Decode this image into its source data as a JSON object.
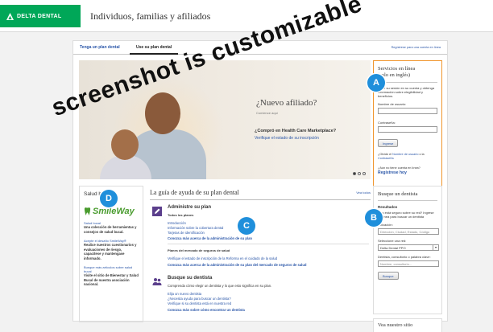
{
  "header": {
    "brand": "DELTA DENTAL",
    "title": "Individuos, familias y afiliados"
  },
  "tabs": [
    {
      "label": "Tenga un plan dental"
    },
    {
      "label": "Use su plan dental"
    }
  ],
  "register_link": "Regístrese para una cuenta en línea",
  "hero": {
    "title": "¿Nuevo afiliado?",
    "subtitle": "Comience aquí",
    "question": "¿Compró en Health Care Marketplace?",
    "link": "Verifique el estado de su inscripción"
  },
  "login": {
    "title_line1": "Servicios en línea",
    "title_line2": "(solo en inglés)",
    "desc": "Inicie su sesión en su cuenta y obtenga información sobre elegibilidad y beneficios.",
    "username_label": "Nombre de usuario:",
    "password_label": "Contraseña:",
    "submit": "Ingrese",
    "forgot_prefix": "¿Olvidó el",
    "forgot_user": "Nombre de usuario",
    "forgot_mid": "o la",
    "forgot_pass": "Contraseña",
    "no_account": "¿Aún no tiene cuenta en línea?",
    "register": "Regístrese hoy"
  },
  "oral_health": {
    "title": "Salud bucal",
    "brand": "SmileWay",
    "line1": "Salud bucal",
    "text": "Una colección de herramientas y consejos de salud bucal.",
    "link": "Acepte el desafío SmileWay®",
    "bold_text": "Realice nuestros cuestionarios y evaluaciones de riesgo, capacítese y mantengase informado.",
    "more_link": "Busque más artículos sobre salud bucal",
    "footer_text": "Visite el sitio de Bienestar y Salud Bucal de nuestra asociación nacional."
  },
  "guide": {
    "title": "La guía de ayuda de su plan dental",
    "view_all": "Vea todos",
    "section1": {
      "heading": "Administre su plan",
      "group1_label": "Todos los planes",
      "links1": [
        "Introducción",
        "Información sobre la cobertura dental",
        "Tarjetas de identificación"
      ],
      "more1": "Conozca más acerca de la administración de su plan",
      "group2_label": "Planes del mercado de seguros de salud",
      "links2": [
        "Verifique el estado de inscripción de la Reforma en el cuidado de la salud"
      ],
      "more2": "Conozca más acerca de la administración de su plan del mercado de seguros de salud"
    },
    "section2": {
      "heading": "Busque su dentista",
      "desc": "Comprenda cómo elegir un dentista y lo que esto significa en su plan.",
      "links": [
        "Elija un nuevo dentista",
        "¿Necesita ayuda para buscar un dentista?",
        "Verifique si su dentista está en nuestra red"
      ],
      "more": "Conozca más sobre cómo encontrar un dentista"
    }
  },
  "dentist_search": {
    "title": "Busque un dentista",
    "heading": "Resultados",
    "text": "¿No está seguro sobre su red? Ingrese en línea para buscar un dentista",
    "location_label": "Ubicación:",
    "location_placeholder": "Dirección, Ciudad, Estado, Código",
    "network_label": "Seleccione una red:",
    "network_value": "Delta Dental PPO",
    "keyword_label": "Dentista, consultorio o palabra clave:",
    "keyword_placeholder": "Nombre, consultorio...",
    "submit": "Busque"
  },
  "site_box": {
    "title": "Vea nuestro sitio"
  },
  "badges": {
    "a": "A",
    "b": "B",
    "c": "C",
    "d": "D"
  },
  "watermark": "screenshot is customizable",
  "colors": {
    "brand_green": "#00a758",
    "accent_orange": "#f0952c",
    "link_blue": "#2a56a8",
    "badge_blue": "#1f8fdb"
  }
}
